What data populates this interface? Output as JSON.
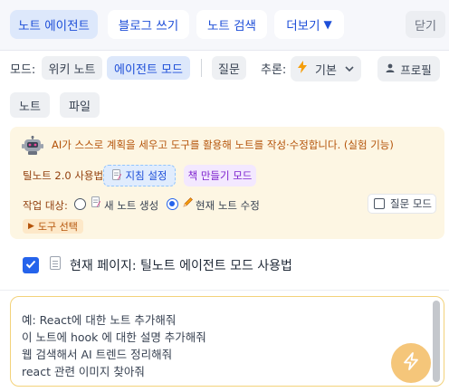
{
  "tabs": [
    {
      "label": "노트 에이전트",
      "active": true
    },
    {
      "label": "블로그 쓰기",
      "active": false
    },
    {
      "label": "노트 검색",
      "active": false
    },
    {
      "label": "더보기",
      "dropdown_glyph": "▼",
      "active": false
    }
  ],
  "close_label": "닫기",
  "mode": {
    "label": "모드:",
    "options": [
      "위키 노트",
      "에이전트 모드"
    ],
    "selected": "에이전트 모드",
    "question": "질문",
    "reasoning_label": "추론:",
    "reasoning_value": "기본",
    "profile": "프로필"
  },
  "tabs2": [
    "노트",
    "파일"
  ],
  "agent": {
    "description": "AI가 스스로 계획을 세우고 도구를 활용해 노트를 작성·수정합니다. (실험 기능)",
    "guide_label": "틸노트 2.0 사용법",
    "guide_button": "지침 설정",
    "book_button": "책 만들기 모드",
    "target_label": "작업 대상:",
    "target_options": [
      "새 노트 생성",
      "현재 노트 수정"
    ],
    "target_selected": "현재 노트 수정",
    "question_mode": "질문 모드",
    "question_mode_checked": false,
    "tools_button": "도구 선택"
  },
  "current_page": {
    "checked": true,
    "text": "현재 페이지: 틸노트 에이전트 모드 사용법"
  },
  "input": {
    "placeholder_lines": [
      "예: React에 대한 노트 추가해줘",
      "이 노트에 hook 에 대한 설명 추가해줘",
      "웹 검색해서 AI 트렌드 정리해줘",
      "react 관련 이미지 찾아줘"
    ]
  },
  "colors": {
    "accent": "#1d4ed8",
    "active_tab_bg": "#dde8fb",
    "agent_panel_bg": "#fdf6e3",
    "agent_text": "#b45309",
    "send_button": "#f5c67a"
  },
  "icons": [
    "lightning-icon",
    "chevron-down-icon",
    "user-icon",
    "robot-icon",
    "pencil-icon",
    "document-icon",
    "checkmark-icon",
    "send-lightning-icon"
  ]
}
